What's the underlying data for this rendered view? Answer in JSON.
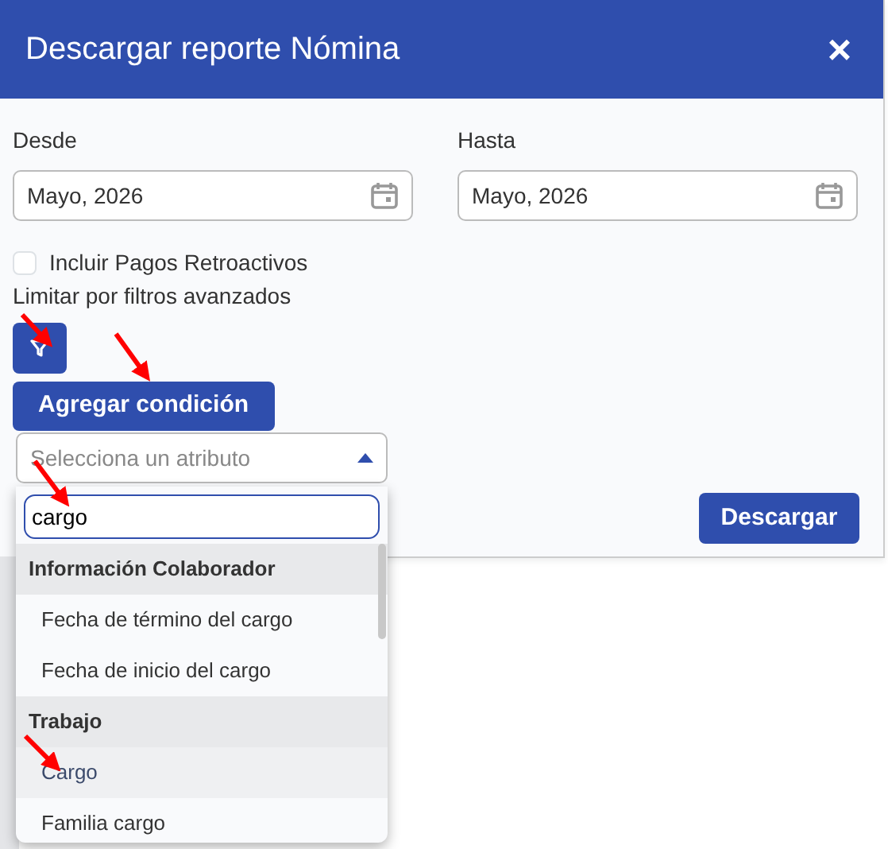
{
  "modal": {
    "title": "Descargar reporte Nómina",
    "close": "×"
  },
  "from": {
    "label": "Desde",
    "value": "Mayo, 2026"
  },
  "to": {
    "label": "Hasta",
    "value": "Mayo, 2026"
  },
  "retro": {
    "label": "Incluir Pagos Retroactivos",
    "checked": false
  },
  "filters_label": "Limitar por filtros avanzados",
  "add_condition": "Agregar condición",
  "attribute_select": {
    "placeholder": "Selecciona un atributo",
    "expanded": true
  },
  "search": {
    "value": "cargo"
  },
  "groups": [
    {
      "label": "Información Colaborador",
      "options": [
        {
          "label": "Fecha de término del cargo",
          "selected": false
        },
        {
          "label": "Fecha de inicio del cargo",
          "selected": false
        }
      ]
    },
    {
      "label": "Trabajo",
      "options": [
        {
          "label": "Cargo",
          "selected": true
        },
        {
          "label": "Familia cargo",
          "selected": false
        }
      ]
    }
  ],
  "download": "Descargar"
}
